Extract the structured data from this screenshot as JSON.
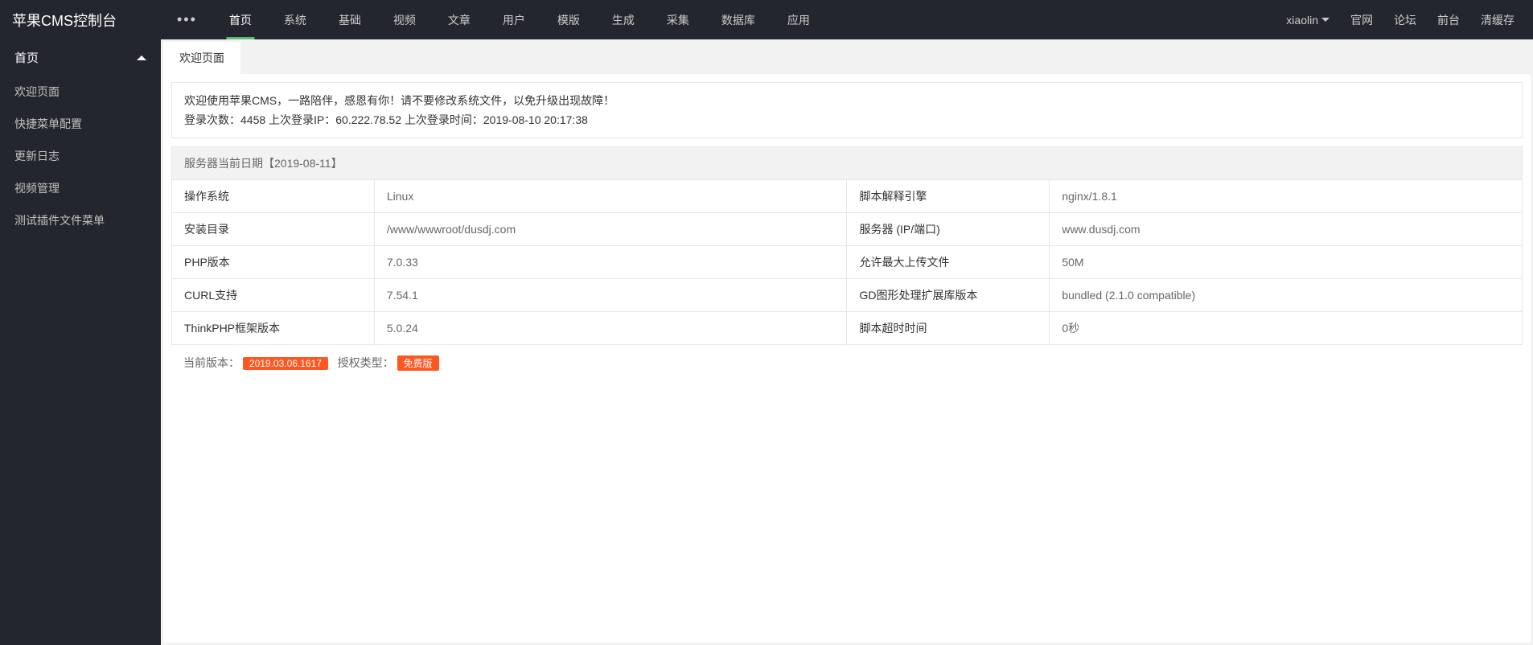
{
  "header": {
    "brand": "苹果CMS控制台",
    "dots": "•••",
    "nav": [
      "首页",
      "系统",
      "基础",
      "视频",
      "文章",
      "用户",
      "模版",
      "生成",
      "采集",
      "数据库",
      "应用"
    ],
    "active_index": 0,
    "user": "xiaolin",
    "right_links": [
      "官网",
      "论坛",
      "前台",
      "清缓存"
    ]
  },
  "sidebar": {
    "title": "首页",
    "items": [
      "欢迎页面",
      "快捷菜单配置",
      "更新日志",
      "视频管理",
      "测试插件文件菜单"
    ]
  },
  "tabs": {
    "active": "欢迎页面"
  },
  "welcome": {
    "line1": "欢迎使用苹果CMS，一路陪伴，感恩有你！请不要修改系统文件，以免升级出现故障！",
    "line2": "登录次数：4458 上次登录IP：60.222.78.52 上次登录时间：2019-08-10 20:17:38"
  },
  "server": {
    "date_title": "服务器当前日期【2019-08-11】",
    "rows": [
      {
        "l1": "操作系统",
        "v1": "Linux",
        "l2": "脚本解释引擎",
        "v2": "nginx/1.8.1"
      },
      {
        "l1": "安装目录",
        "v1": "/www/wwwroot/dusdj.com",
        "l2": "服务器 (IP/端口)",
        "v2": "www.dusdj.com"
      },
      {
        "l1": "PHP版本",
        "v1": "7.0.33",
        "l2": "允许最大上传文件",
        "v2": "50M"
      },
      {
        "l1": "CURL支持",
        "v1": "7.54.1",
        "l2": "GD图形处理扩展库版本",
        "v2": "bundled (2.1.0 compatible)"
      },
      {
        "l1": "ThinkPHP框架版本",
        "v1": "5.0.24",
        "l2": "脚本超时时间",
        "v2": "0秒"
      }
    ]
  },
  "version": {
    "current_label": "当前版本：",
    "current_value": "2019.03.06.1617",
    "license_label": "授权类型：",
    "license_value": "免费版"
  }
}
